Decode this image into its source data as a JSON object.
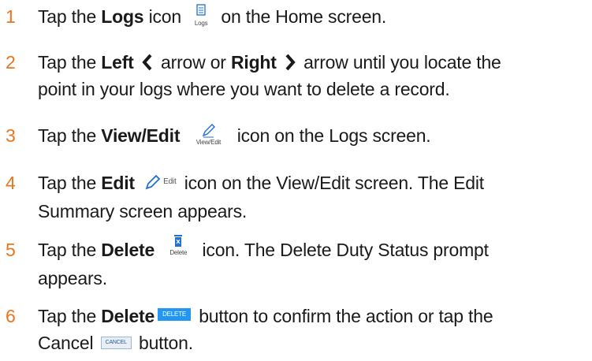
{
  "steps": [
    {
      "number": "1",
      "before": "Tap the ",
      "bold": "Logs",
      "mid": " icon ",
      "icon": "logs-icon",
      "icon_caption": "Logs",
      "after": " on the Home screen."
    },
    {
      "number": "2",
      "before": "Tap the ",
      "bold1": "Left",
      "left_icon": "chevron-left-icon",
      "mid": " arrow or ",
      "bold2": "Right",
      "right_icon": "chevron-right-icon",
      "line1_end": " arrow until you locate the",
      "line2": "point in your logs where you want to delete a record."
    },
    {
      "number": "3",
      "before": "Tap the ",
      "bold": "View/Edit",
      "icon": "pencil-icon",
      "icon_caption": "View/Edit",
      "after": " icon on the Logs screen."
    },
    {
      "number": "4",
      "before": "Tap the ",
      "bold": "Edit",
      "icon": "pencil-icon",
      "icon_caption": "Edit",
      "line1_end": " icon on the View/Edit screen. The Edit",
      "line2": "Summary screen appears."
    },
    {
      "number": "5",
      "before": "Tap the ",
      "bold": "Delete",
      "icon": "trash-icon",
      "icon_caption": "Delete",
      "line1_end": " icon. The Delete Duty Status prompt",
      "line2": "appears."
    },
    {
      "number": "6",
      "before": "Tap the ",
      "bold": "Delete",
      "button_label": "DELETE",
      "line1_end": " button to confirm the action or tap the",
      "line2_before": "Cancel ",
      "cancel_label": "CANCEL",
      "line2_after": " button."
    }
  ],
  "colors": {
    "number": "#e8761e",
    "icon": "#1e6fd9",
    "delete_button_bg": "#2196f3"
  }
}
